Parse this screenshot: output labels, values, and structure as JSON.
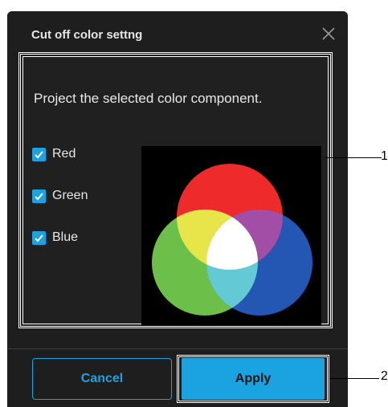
{
  "dialog": {
    "title": "Cut off color settng",
    "description": "Project the selected color component.",
    "checkboxes": [
      {
        "label": "Red",
        "checked": true
      },
      {
        "label": "Green",
        "checked": true
      },
      {
        "label": "Blue",
        "checked": true
      }
    ],
    "cancel_label": "Cancel",
    "apply_label": "Apply"
  },
  "callouts": {
    "one": "1",
    "two": "2"
  },
  "colors": {
    "accent": "#1aa3e0",
    "background": "#1e1e1e",
    "red": "#ee2a2a",
    "green": "#6cc04a",
    "blue": "#2457b4",
    "yellow": "#e8e54a",
    "magenta": "#a24ea6",
    "cyan": "#63c9d4",
    "white": "#ffffff"
  },
  "icons": {
    "close": "close-icon",
    "check": "checkmark-icon",
    "venn": "rgb-venn-diagram"
  }
}
